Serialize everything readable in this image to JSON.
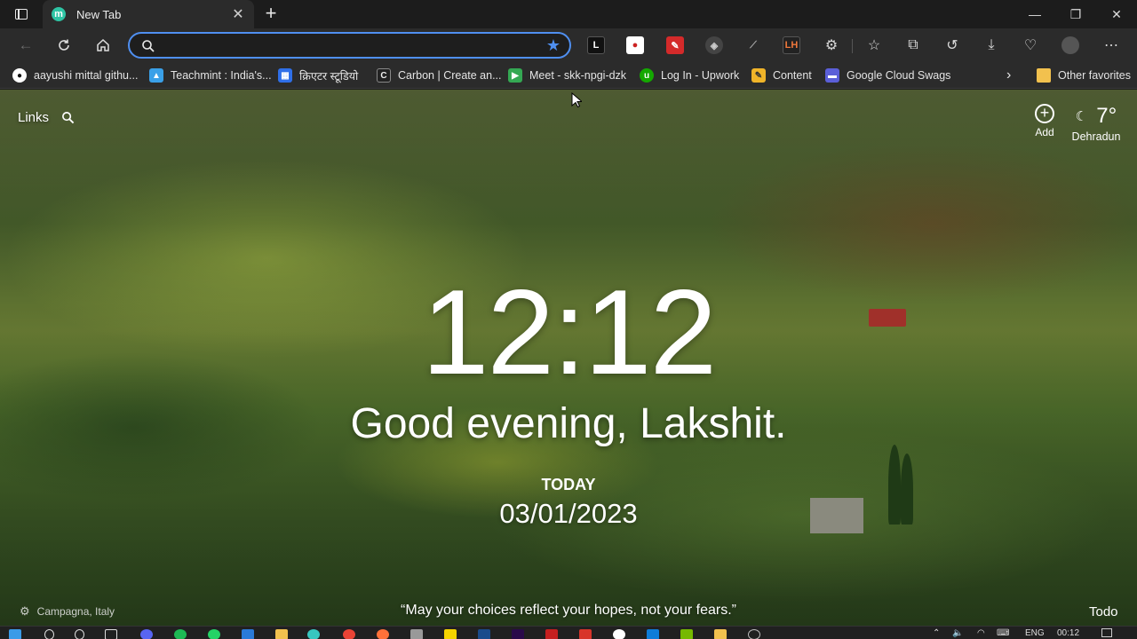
{
  "browser": {
    "tab_title": "New Tab",
    "tab_favicon_letter": "m",
    "address_value": "",
    "address_placeholder": ""
  },
  "favorites": [
    {
      "label": "aayushi mittal githu...",
      "icon": "github-icon",
      "color": "#ffffff"
    },
    {
      "label": "Teachmint : India's...",
      "icon": "teachmint-icon",
      "color": "#3aa0e8"
    },
    {
      "label": "क्रिएटर स्टूडियो",
      "icon": "creator-studio-icon",
      "color": "#2f6fe8"
    },
    {
      "label": "Carbon | Create an...",
      "icon": "carbon-icon",
      "color": "#e8e8e8"
    },
    {
      "label": "Meet - skk-npgi-dzk",
      "icon": "google-meet-icon",
      "color": "#34a853"
    },
    {
      "label": "Log In - Upwork",
      "icon": "upwork-icon",
      "color": "#14a800"
    },
    {
      "label": "Content",
      "icon": "content-icon",
      "color": "#f0b429"
    },
    {
      "label": "Google Cloud Swags",
      "icon": "google-cloud-icon",
      "color": "#5b5fd8"
    }
  ],
  "other_favorites": "Other favorites",
  "widgets": {
    "links_label": "Links",
    "add_label": "Add",
    "temperature": "7°",
    "city": "Dehradun"
  },
  "clock": {
    "time": "12:12",
    "greeting": "Good evening, Lakshit.",
    "today_label": "TODAY",
    "date": "03/01/2023"
  },
  "footer": {
    "location": "Campagna, Italy",
    "quote": "“May your choices reflect your hopes, not your fears.”",
    "todo": "Todo"
  },
  "taskbar": {
    "language": "ENG",
    "time": "00:12"
  },
  "colors": {
    "accent": "#4f8ff0",
    "tab_active": "#2b2b2b",
    "titlebar": "#1c1c1c"
  }
}
